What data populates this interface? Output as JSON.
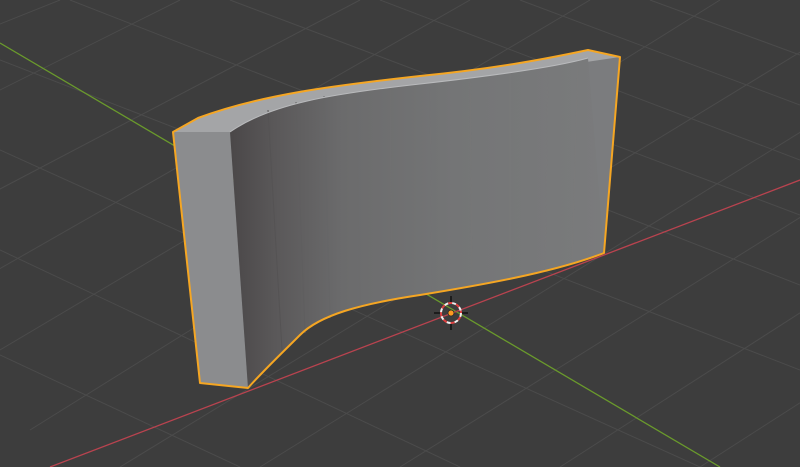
{
  "viewport": {
    "background_color": "#3d3d3d",
    "grid_line_color": "#4a4a4a",
    "x_axis_color": "#b9434f",
    "y_axis_color": "#6a9a2c"
  },
  "selected_object": {
    "selected": true,
    "outline_color": "#f5a623",
    "front_face_color": "#8c8d8f",
    "inner_face_color": "#6e6e70",
    "top_face_color": "#a4a5a7",
    "side_face_color": "#7a7b7d"
  },
  "cursor_3d": {
    "icon": "3d-cursor-icon",
    "ring_color_a": "#e04040",
    "ring_color_b": "#f0f0f0",
    "origin_color": "#ff9a1f"
  }
}
